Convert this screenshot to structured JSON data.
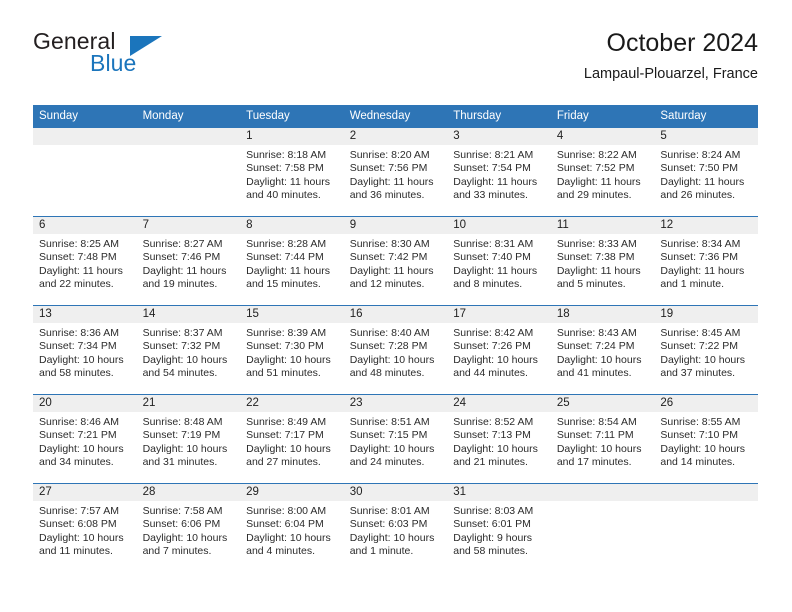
{
  "brand": {
    "name_top": "General",
    "name_bottom": "Blue",
    "triangle_icon": "brand-triangle-icon",
    "accent_color": "#1b75bc"
  },
  "header": {
    "title": "October 2024",
    "subtitle": "Lampaul-Plouarzel, France"
  },
  "theme": {
    "header_blue": "#2e75b6",
    "band_gray": "#efefef"
  },
  "calendar": {
    "weekday_headers": [
      "Sunday",
      "Monday",
      "Tuesday",
      "Wednesday",
      "Thursday",
      "Friday",
      "Saturday"
    ],
    "weeks": [
      [
        {
          "day": "",
          "lines": [],
          "empty": true
        },
        {
          "day": "",
          "lines": [],
          "empty": true
        },
        {
          "day": "1",
          "lines": [
            "Sunrise: 8:18 AM",
            "Sunset: 7:58 PM",
            "Daylight: 11 hours",
            "and 40 minutes."
          ]
        },
        {
          "day": "2",
          "lines": [
            "Sunrise: 8:20 AM",
            "Sunset: 7:56 PM",
            "Daylight: 11 hours",
            "and 36 minutes."
          ]
        },
        {
          "day": "3",
          "lines": [
            "Sunrise: 8:21 AM",
            "Sunset: 7:54 PM",
            "Daylight: 11 hours",
            "and 33 minutes."
          ]
        },
        {
          "day": "4",
          "lines": [
            "Sunrise: 8:22 AM",
            "Sunset: 7:52 PM",
            "Daylight: 11 hours",
            "and 29 minutes."
          ]
        },
        {
          "day": "5",
          "lines": [
            "Sunrise: 8:24 AM",
            "Sunset: 7:50 PM",
            "Daylight: 11 hours",
            "and 26 minutes."
          ]
        }
      ],
      [
        {
          "day": "6",
          "lines": [
            "Sunrise: 8:25 AM",
            "Sunset: 7:48 PM",
            "Daylight: 11 hours",
            "and 22 minutes."
          ]
        },
        {
          "day": "7",
          "lines": [
            "Sunrise: 8:27 AM",
            "Sunset: 7:46 PM",
            "Daylight: 11 hours",
            "and 19 minutes."
          ]
        },
        {
          "day": "8",
          "lines": [
            "Sunrise: 8:28 AM",
            "Sunset: 7:44 PM",
            "Daylight: 11 hours",
            "and 15 minutes."
          ]
        },
        {
          "day": "9",
          "lines": [
            "Sunrise: 8:30 AM",
            "Sunset: 7:42 PM",
            "Daylight: 11 hours",
            "and 12 minutes."
          ]
        },
        {
          "day": "10",
          "lines": [
            "Sunrise: 8:31 AM",
            "Sunset: 7:40 PM",
            "Daylight: 11 hours",
            "and 8 minutes."
          ]
        },
        {
          "day": "11",
          "lines": [
            "Sunrise: 8:33 AM",
            "Sunset: 7:38 PM",
            "Daylight: 11 hours",
            "and 5 minutes."
          ]
        },
        {
          "day": "12",
          "lines": [
            "Sunrise: 8:34 AM",
            "Sunset: 7:36 PM",
            "Daylight: 11 hours",
            "and 1 minute."
          ]
        }
      ],
      [
        {
          "day": "13",
          "lines": [
            "Sunrise: 8:36 AM",
            "Sunset: 7:34 PM",
            "Daylight: 10 hours",
            "and 58 minutes."
          ]
        },
        {
          "day": "14",
          "lines": [
            "Sunrise: 8:37 AM",
            "Sunset: 7:32 PM",
            "Daylight: 10 hours",
            "and 54 minutes."
          ]
        },
        {
          "day": "15",
          "lines": [
            "Sunrise: 8:39 AM",
            "Sunset: 7:30 PM",
            "Daylight: 10 hours",
            "and 51 minutes."
          ]
        },
        {
          "day": "16",
          "lines": [
            "Sunrise: 8:40 AM",
            "Sunset: 7:28 PM",
            "Daylight: 10 hours",
            "and 48 minutes."
          ]
        },
        {
          "day": "17",
          "lines": [
            "Sunrise: 8:42 AM",
            "Sunset: 7:26 PM",
            "Daylight: 10 hours",
            "and 44 minutes."
          ]
        },
        {
          "day": "18",
          "lines": [
            "Sunrise: 8:43 AM",
            "Sunset: 7:24 PM",
            "Daylight: 10 hours",
            "and 41 minutes."
          ]
        },
        {
          "day": "19",
          "lines": [
            "Sunrise: 8:45 AM",
            "Sunset: 7:22 PM",
            "Daylight: 10 hours",
            "and 37 minutes."
          ]
        }
      ],
      [
        {
          "day": "20",
          "lines": [
            "Sunrise: 8:46 AM",
            "Sunset: 7:21 PM",
            "Daylight: 10 hours",
            "and 34 minutes."
          ]
        },
        {
          "day": "21",
          "lines": [
            "Sunrise: 8:48 AM",
            "Sunset: 7:19 PM",
            "Daylight: 10 hours",
            "and 31 minutes."
          ]
        },
        {
          "day": "22",
          "lines": [
            "Sunrise: 8:49 AM",
            "Sunset: 7:17 PM",
            "Daylight: 10 hours",
            "and 27 minutes."
          ]
        },
        {
          "day": "23",
          "lines": [
            "Sunrise: 8:51 AM",
            "Sunset: 7:15 PM",
            "Daylight: 10 hours",
            "and 24 minutes."
          ]
        },
        {
          "day": "24",
          "lines": [
            "Sunrise: 8:52 AM",
            "Sunset: 7:13 PM",
            "Daylight: 10 hours",
            "and 21 minutes."
          ]
        },
        {
          "day": "25",
          "lines": [
            "Sunrise: 8:54 AM",
            "Sunset: 7:11 PM",
            "Daylight: 10 hours",
            "and 17 minutes."
          ]
        },
        {
          "day": "26",
          "lines": [
            "Sunrise: 8:55 AM",
            "Sunset: 7:10 PM",
            "Daylight: 10 hours",
            "and 14 minutes."
          ]
        }
      ],
      [
        {
          "day": "27",
          "lines": [
            "Sunrise: 7:57 AM",
            "Sunset: 6:08 PM",
            "Daylight: 10 hours",
            "and 11 minutes."
          ]
        },
        {
          "day": "28",
          "lines": [
            "Sunrise: 7:58 AM",
            "Sunset: 6:06 PM",
            "Daylight: 10 hours",
            "and 7 minutes."
          ]
        },
        {
          "day": "29",
          "lines": [
            "Sunrise: 8:00 AM",
            "Sunset: 6:04 PM",
            "Daylight: 10 hours",
            "and 4 minutes."
          ]
        },
        {
          "day": "30",
          "lines": [
            "Sunrise: 8:01 AM",
            "Sunset: 6:03 PM",
            "Daylight: 10 hours",
            "and 1 minute."
          ]
        },
        {
          "day": "31",
          "lines": [
            "Sunrise: 8:03 AM",
            "Sunset: 6:01 PM",
            "Daylight: 9 hours",
            "and 58 minutes."
          ]
        },
        {
          "day": "",
          "lines": [],
          "empty": true
        },
        {
          "day": "",
          "lines": [],
          "empty": true
        }
      ]
    ]
  }
}
